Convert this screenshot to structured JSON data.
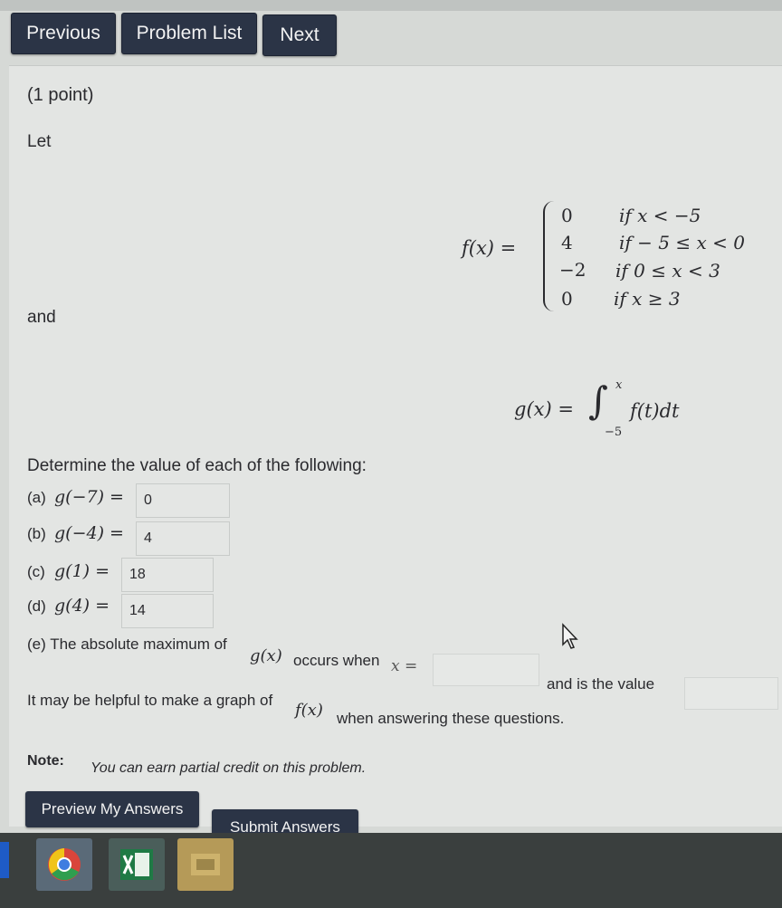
{
  "nav": {
    "previous": "Previous",
    "problem_list": "Problem List",
    "next": "Next"
  },
  "problem": {
    "points": "(1 point)",
    "let": "Let",
    "and": "and",
    "f_lhs": "f(x) =",
    "f_cases": [
      {
        "value": "0",
        "cond": "if x < −5"
      },
      {
        "value": "4",
        "cond": "if − 5 ≤ x < 0"
      },
      {
        "value": "−2",
        "cond": "if 0 ≤ x < 3"
      },
      {
        "value": "0",
        "cond": "if x ≥ 3"
      }
    ],
    "g_lhs": "g(x) =",
    "g_integral": "∫",
    "g_upper": "x",
    "g_lower": "−5",
    "g_integrand": "f(t)dt",
    "instructions": "Determine the value of each of the following:",
    "parts": [
      {
        "label": "(a)",
        "expr": "g(−7) =",
        "answer": "0"
      },
      {
        "label": "(b)",
        "expr": "g(−4) =",
        "answer": "4"
      },
      {
        "label": "(c)",
        "expr": "g(1) =",
        "answer": "18"
      },
      {
        "label": "(d)",
        "expr": "g(4) =",
        "answer": "14"
      }
    ],
    "part_e_prefix": "(e) The absolute maximum of",
    "part_e_gx": "g(x)",
    "part_e_mid": "occurs when",
    "part_e_x": "x =",
    "part_e_suffix": "and is the value",
    "hint_prefix": "It may be helpful to make a graph of",
    "hint_fx": "f(x)",
    "hint_suffix": "when answering these questions.",
    "note_label": "Note:",
    "note_text": "You can earn partial credit on this problem."
  },
  "actions": {
    "preview": "Preview My Answers",
    "submit": "Submit Answers"
  },
  "taskbar": {
    "icons": [
      "chrome-icon",
      "excel-icon",
      "app-icon"
    ]
  }
}
